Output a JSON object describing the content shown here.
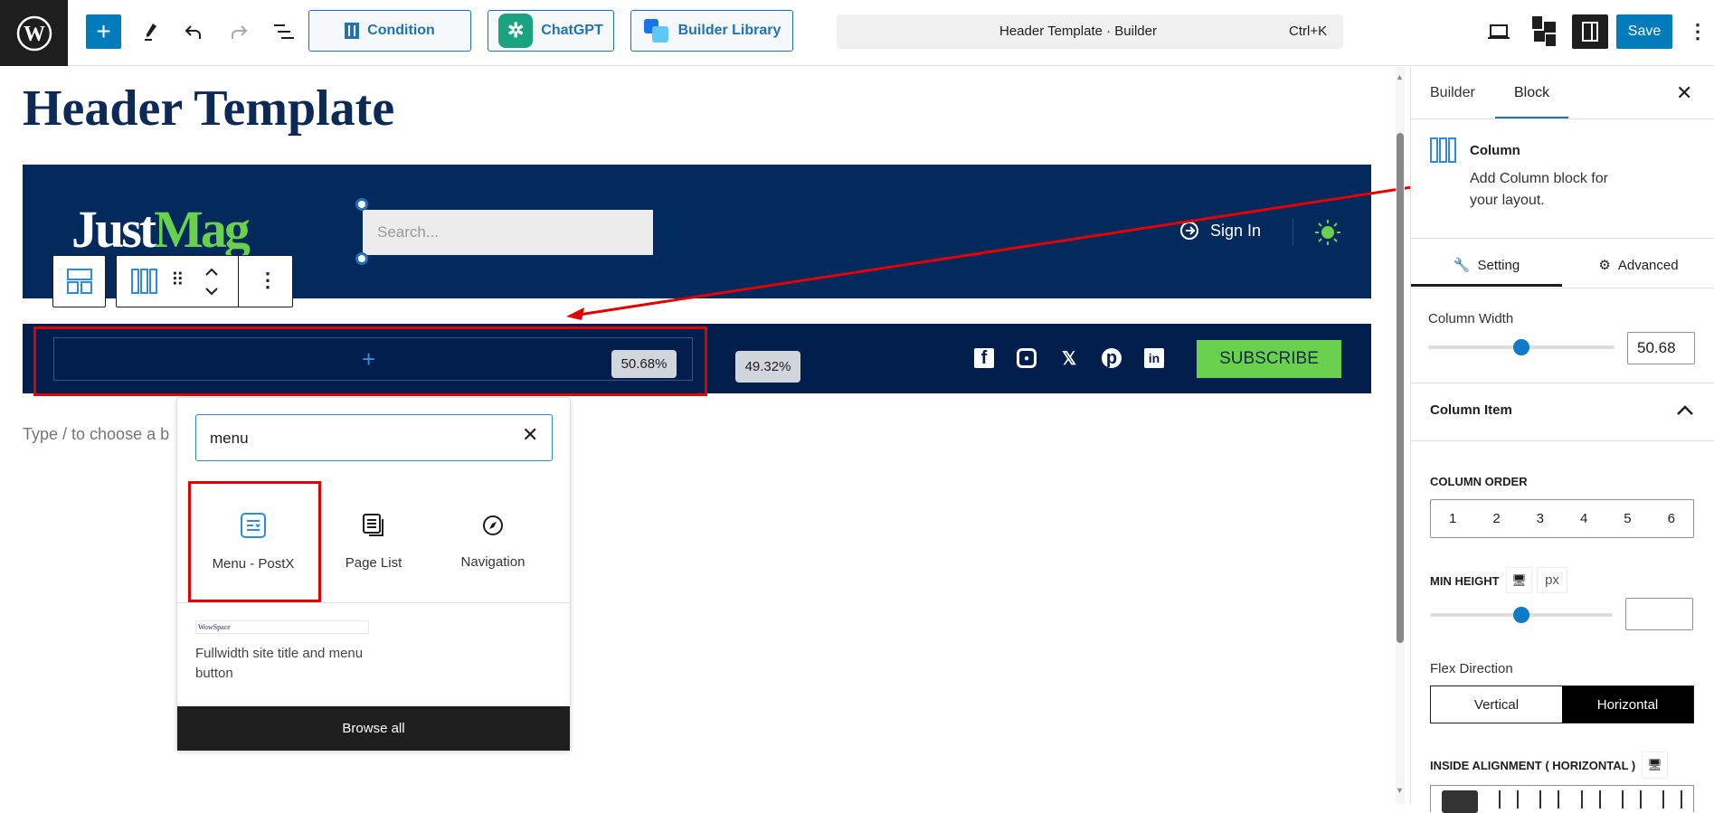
{
  "toolbar": {
    "condition": "Condition",
    "chatgpt": "ChatGPT",
    "builder_library": "Builder Library",
    "command_title": "Header Template · Builder",
    "shortcut": "Ctrl+K",
    "save": "Save",
    "accent": "#007cba"
  },
  "canvas": {
    "page_title": "Header Template",
    "logo_text_1": "Just",
    "logo_text_2": "Mag",
    "search_placeholder": "Search...",
    "sign_in": "Sign In",
    "col1_width": "50.68%",
    "col2_width": "49.32%",
    "subscribe": "SUBSCRIBE",
    "socials": [
      "facebook",
      "instagram",
      "x",
      "pinterest",
      "linkedin"
    ],
    "type_hint": "Type / to choose a b",
    "header_bg": "#032a5c",
    "brand_green": "#6ad14e"
  },
  "inserter": {
    "search_value": "menu",
    "items": [
      {
        "label": "Menu - PostX",
        "icon": "menu-icon"
      },
      {
        "label": "Page List",
        "icon": "page-list-icon"
      },
      {
        "label": "Navigation",
        "icon": "compass-icon"
      }
    ],
    "pattern_thumb": "WowSpace",
    "pattern_desc": "Fullwidth site title and menu button",
    "browse_all": "Browse all"
  },
  "sidebar": {
    "tabs": [
      "Builder",
      "Block"
    ],
    "active_tab": "Block",
    "block_name": "Column",
    "block_desc": "Add Column block for your layout.",
    "subtabs": [
      "Setting",
      "Advanced"
    ],
    "column_width_label": "Column Width",
    "column_width": "50.68",
    "column_width_value": 50.68,
    "column_item": "Column Item",
    "column_order_label": "COLUMN ORDER",
    "column_order": [
      "1",
      "2",
      "3",
      "4",
      "5",
      "6"
    ],
    "min_height_label": "MIN HEIGHT",
    "unit": "px",
    "min_height": "",
    "flex_direction_label": "Flex Direction",
    "flex_options": [
      "Vertical",
      "Horizontal"
    ],
    "flex_selected": "Horizontal",
    "inside_alignment_label": "INSIDE ALIGNMENT ( HORIZONTAL )"
  }
}
